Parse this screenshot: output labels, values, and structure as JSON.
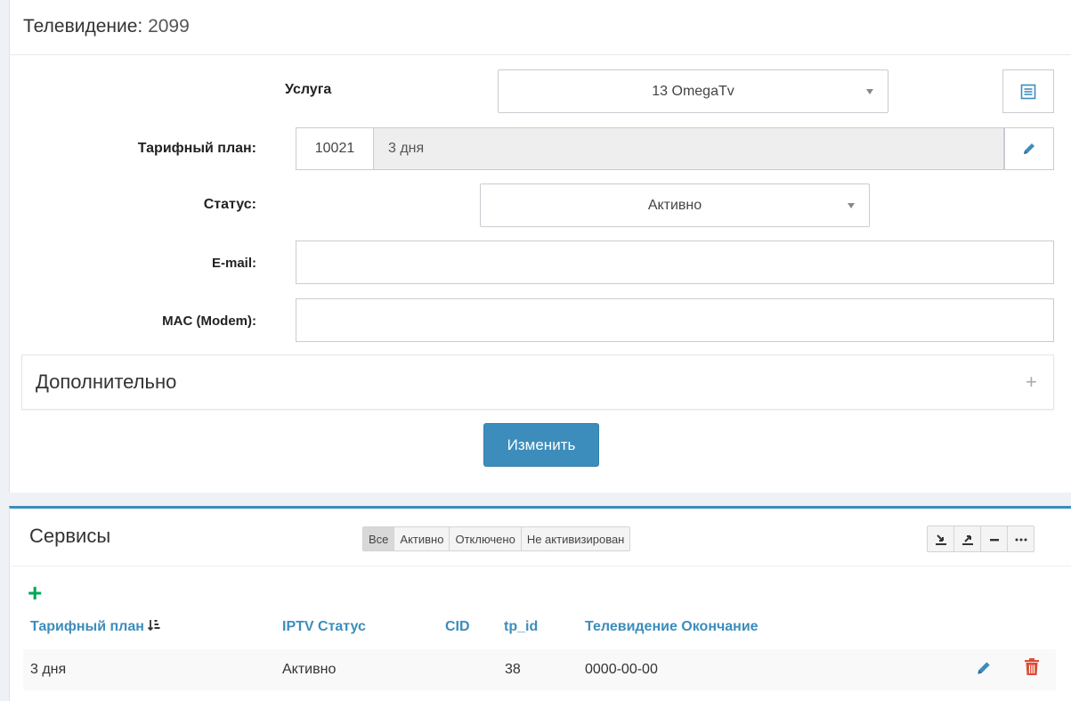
{
  "panel": {
    "title": "Телевидение:",
    "id": "2099"
  },
  "form": {
    "service": {
      "label": "Услуга",
      "value": "13 OmegaTv"
    },
    "tariff": {
      "label": "Тарифный план:",
      "code": "10021",
      "name": "3 дня"
    },
    "status": {
      "label": "Статус:",
      "value": "Активно"
    },
    "email": {
      "label": "E-mail:",
      "value": ""
    },
    "mac": {
      "label": "MAC (Modem):",
      "value": ""
    },
    "extra": {
      "title": "Дополнительно",
      "toggle": "+"
    },
    "submit_label": "Изменить"
  },
  "services": {
    "title": "Сервисы",
    "filters": [
      "Все",
      "Активно",
      "Отключено",
      "Не активизирован"
    ],
    "add": "+",
    "columns": [
      "Тарифный план",
      "IPTV Статус",
      "CID",
      "tp_id",
      "Телевидение Окончание"
    ],
    "rows": [
      {
        "tariff": "3 дня",
        "status": "Активно",
        "cid": "",
        "tp_id": "38",
        "end": "0000-00-00"
      }
    ]
  },
  "colors": {
    "primary": "#3c8dbc",
    "success": "#00a65a",
    "danger": "#dd4b39"
  },
  "icons": {
    "service_info": "list-icon",
    "edit": "pencil-icon",
    "sort": "sort-amount-icon",
    "delete": "trash-icon",
    "import": "import-icon",
    "export": "export-icon",
    "collapse": "minus-icon",
    "more": "ellipsis-icon"
  }
}
